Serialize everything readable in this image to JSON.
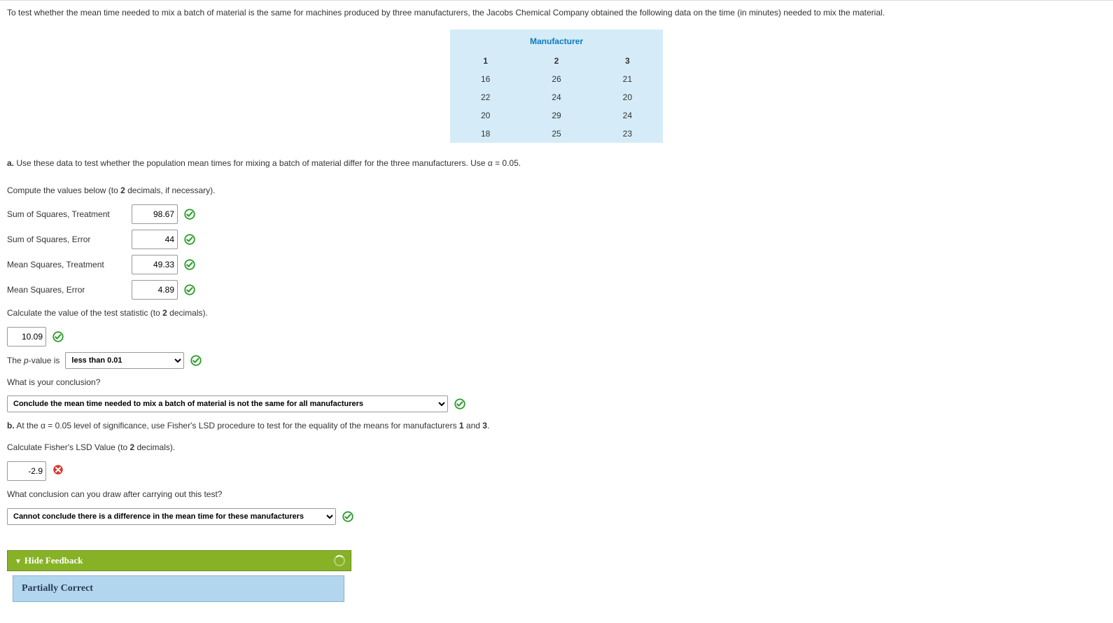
{
  "prompt": "To test whether the mean time needed to mix a batch of material is the same for machines produced by three manufacturers, the Jacobs Chemical Company obtained the following data on the time (in minutes) needed to mix the material.",
  "table": {
    "header": "Manufacturer",
    "cols": [
      "1",
      "2",
      "3"
    ],
    "rows": [
      [
        "16",
        "26",
        "21"
      ],
      [
        "22",
        "24",
        "20"
      ],
      [
        "20",
        "29",
        "24"
      ],
      [
        "18",
        "25",
        "23"
      ]
    ]
  },
  "a": {
    "lead": "a.",
    "text": " Use these data to test whether the population mean times for mixing a batch of material differ for the three manufacturers. Use α = 0.05.",
    "compute": "Compute the values below (to 2 decimals, if necessary).",
    "rows": {
      "sst": {
        "label": "Sum of Squares, Treatment",
        "value": "98.67"
      },
      "sse": {
        "label": "Sum of Squares, Error",
        "value": "44"
      },
      "mst": {
        "label": "Mean Squares, Treatment",
        "value": "49.33"
      },
      "mse": {
        "label": "Mean Squares, Error",
        "value": "4.89"
      }
    },
    "calc_stat": "Calculate the value of the test statistic (to 2 decimals).",
    "test_stat": "10.09",
    "pvalue_prefix": "The ",
    "pvalue_var": "p",
    "pvalue_suffix": "-value is",
    "pvalue_option": "less than 0.01",
    "conclusion_q": "What is your conclusion?",
    "conclusion_option": "Conclude the mean time needed to mix a batch of material is not the same for all manufacturers"
  },
  "b": {
    "lead": "b.",
    "text": " At the α = 0.05 level of significance, use Fisher's LSD procedure to test for the equality of the means for manufacturers 1 and 3.",
    "calc_lsd": "Calculate Fisher's LSD Value (to 2 decimals).",
    "lsd_value": "-2.9",
    "conclusion_q": "What conclusion can you draw after carrying out this test?",
    "conclusion_option": "Cannot conclude there is a difference in the mean time for these manufacturers"
  },
  "feedback": {
    "header": "Hide Feedback",
    "status": "Partially Correct"
  }
}
